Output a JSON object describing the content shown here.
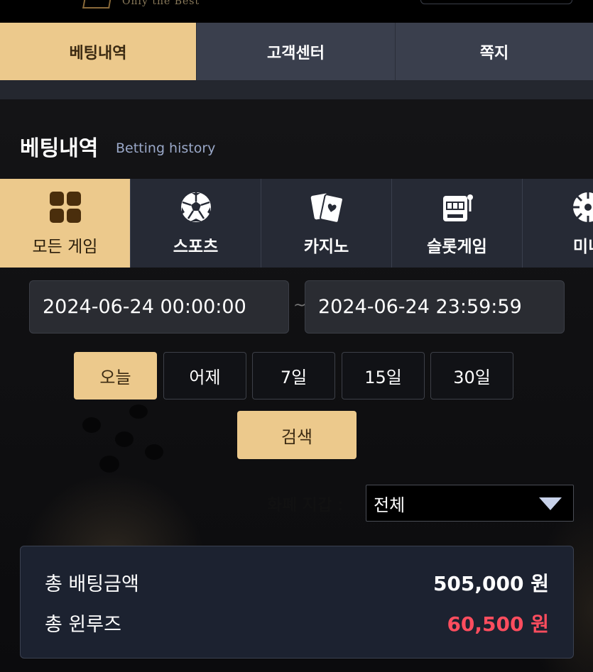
{
  "header": {
    "logo_text": "Only the Best"
  },
  "top_nav": [
    {
      "label": "베팅내역",
      "active": true
    },
    {
      "label": "고객센터",
      "active": false
    },
    {
      "label": "쪽지",
      "active": false
    }
  ],
  "page": {
    "title": "베팅내역",
    "subtitle": "Betting history"
  },
  "game_tabs": [
    {
      "label": "모든 게임",
      "icon": "grid-icon",
      "active": true
    },
    {
      "label": "스포츠",
      "icon": "soccer-ball-icon",
      "active": false
    },
    {
      "label": "카지노",
      "icon": "playing-cards-icon",
      "active": false
    },
    {
      "label": "슬롯게임",
      "icon": "slot-machine-icon",
      "active": false
    },
    {
      "label": "미니",
      "icon": "mini-game-icon",
      "active": false
    }
  ],
  "date_range": {
    "start": "2024-06-24 00:00:00",
    "separator": "~",
    "end": "2024-06-24 23:59:59"
  },
  "quick_ranges": [
    {
      "label": "오늘",
      "active": true
    },
    {
      "label": "어제",
      "active": false
    },
    {
      "label": "7일",
      "active": false
    },
    {
      "label": "15일",
      "active": false
    },
    {
      "label": "30일",
      "active": false
    }
  ],
  "search_label": "검색",
  "currency_filter": {
    "label": "화폐 지갑 :",
    "selected": "전체"
  },
  "summary": {
    "total_bet_label": "총 배팅금액",
    "total_bet_value": "505,000 원",
    "total_win_label": "총 윈루즈",
    "total_win_value": "60,500 원"
  },
  "colors": {
    "accent": "#ecc98c",
    "win_value": "#ff4d5e",
    "nav_inactive": "#3a3f4d"
  }
}
